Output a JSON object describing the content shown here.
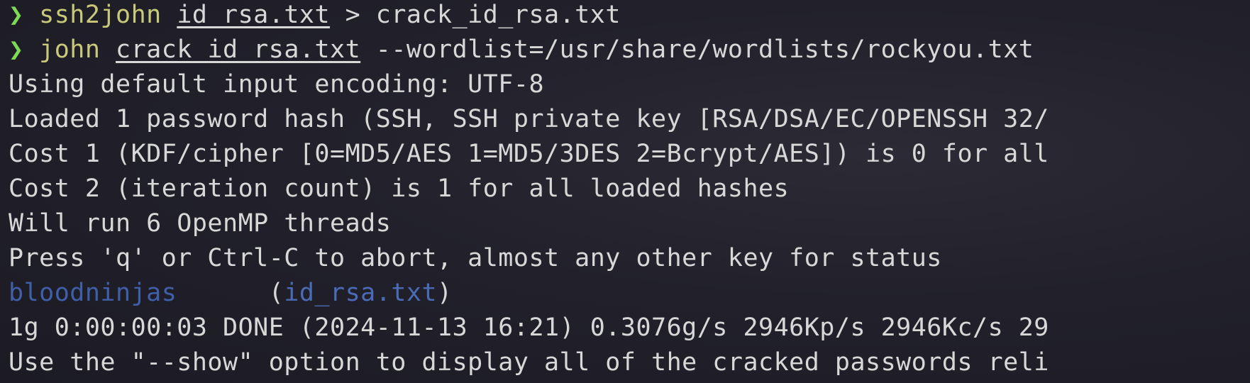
{
  "terminal": {
    "prompt_symbol": "❯",
    "lines": [
      {
        "type": "command",
        "cmd": "ssh2john",
        "sp1": " ",
        "arg": "id_rsa.txt",
        "rest": " > crack_id_rsa.txt"
      },
      {
        "type": "command",
        "cmd": "john",
        "sp1": " ",
        "arg": "crack_id_rsa.txt",
        "rest": " --wordlist=/usr/share/wordlists/rockyou.txt"
      },
      {
        "type": "output",
        "text": "Using default input encoding: UTF-8"
      },
      {
        "type": "output",
        "text": "Loaded 1 password hash (SSH, SSH private key [RSA/DSA/EC/OPENSSH 32/"
      },
      {
        "type": "output",
        "text": "Cost 1 (KDF/cipher [0=MD5/AES 1=MD5/3DES 2=Bcrypt/AES]) is 0 for all"
      },
      {
        "type": "output",
        "text": "Cost 2 (iteration count) is 1 for all loaded hashes"
      },
      {
        "type": "output",
        "text": "Will run 6 OpenMP threads"
      },
      {
        "type": "output",
        "text": "Press 'q' or Ctrl-C to abort, almost any other key for status"
      },
      {
        "type": "result",
        "password": "bloodninjas",
        "gap": "      ",
        "open": "(",
        "file": "id_rsa.txt",
        "close": ")"
      },
      {
        "type": "output",
        "text": "1g 0:00:00:03 DONE (2024-11-13 16:21) 0.3076g/s 2946Kp/s 2946Kc/s 29"
      },
      {
        "type": "output",
        "text": "Use the \"--show\" option to display all of the cracked passwords reli"
      }
    ]
  },
  "colors": {
    "background": "#22212b",
    "prompt": "#7ed957",
    "command": "#c9c97a",
    "text": "#d8d8d8",
    "password": "#3f5fa8",
    "file": "#4a6bb5"
  }
}
